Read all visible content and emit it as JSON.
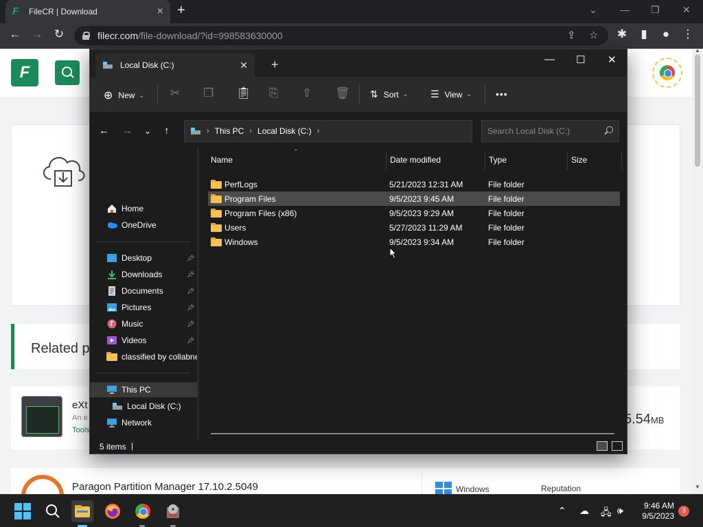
{
  "browser": {
    "tab_title": "FileCR | Download",
    "url_host": "filecr.com",
    "url_path": "/file-download/?id=998583630000"
  },
  "webpage": {
    "related_heading": "Related p",
    "item1": {
      "title": "eXt",
      "desc": "An e",
      "category": "Tools",
      "size_value": "5.54",
      "size_unit": "MB"
    },
    "item2": {
      "title": "Paragon Partition Manager 17.10.2.5049",
      "platform": "Windows",
      "reputation": "Reputation"
    }
  },
  "explorer": {
    "tab_title": "Local Disk (C:)",
    "commands": {
      "new": "New",
      "sort": "Sort",
      "view": "View",
      "more": "•••"
    },
    "breadcrumb": [
      "This PC",
      "Local Disk (C:)"
    ],
    "search_placeholder": "Search Local Disk (C:)",
    "nav": {
      "home": "Home",
      "onedrive": "OneDrive",
      "desktop": "Desktop",
      "downloads": "Downloads",
      "documents": "Documents",
      "pictures": "Pictures",
      "music": "Music",
      "videos": "Videos",
      "classified": "classified by collabne",
      "thispc": "This PC",
      "localdisk": "Local Disk (C:)",
      "network": "Network"
    },
    "columns": {
      "name": "Name",
      "date": "Date modified",
      "type": "Type",
      "size": "Size"
    },
    "files": [
      {
        "name": "PerfLogs",
        "date": "5/21/2023 12:31 AM",
        "type": "File folder"
      },
      {
        "name": "Program Files",
        "date": "9/5/2023 9:45 AM",
        "type": "File folder"
      },
      {
        "name": "Program Files (x86)",
        "date": "9/5/2023 9:29 AM",
        "type": "File folder"
      },
      {
        "name": "Users",
        "date": "5/27/2023 11:29 AM",
        "type": "File folder"
      },
      {
        "name": "Windows",
        "date": "9/5/2023 9:34 AM",
        "type": "File folder"
      }
    ],
    "status": "5 items"
  },
  "taskbar": {
    "time": "9:46 AM",
    "date": "9/5/2023",
    "notifications": "3"
  },
  "colors": {
    "accent": "#1b8a5a",
    "folder": "#f4c04e",
    "explorer_bg": "#1c1c1c",
    "win_accent": "#60cdff"
  }
}
